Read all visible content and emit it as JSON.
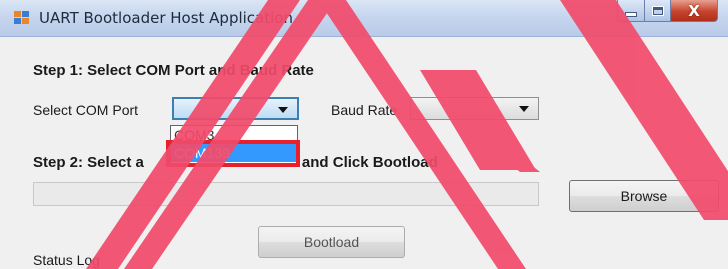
{
  "window": {
    "title": "UART Bootloader Host Application",
    "close_glyph": "X"
  },
  "step1": {
    "heading": "Step 1: Select COM Port and Baud Rate",
    "com_label": "Select COM Port",
    "baud_label": "Baud Rate",
    "com_selected": "",
    "baud_selected": ""
  },
  "com_dropdown": {
    "options": [
      "COM3",
      "COM139"
    ],
    "highlighted_index": 1
  },
  "step2": {
    "heading_left": "Step 2: Select a",
    "heading_right": "File and Click Bootload",
    "file_path": ""
  },
  "buttons": {
    "browse": "Browse",
    "bootload": "Bootload"
  },
  "status": {
    "label": "Status Log"
  },
  "colors": {
    "annotation_red": "#e8202b",
    "overlay_pink": "#f24b6b",
    "selection_blue": "#3399ff"
  },
  "icons": {
    "app": "app-icon",
    "minimize": "minimize-icon",
    "maximize": "maximize-icon",
    "close": "close-icon",
    "dropdown": "chevron-down-icon"
  }
}
